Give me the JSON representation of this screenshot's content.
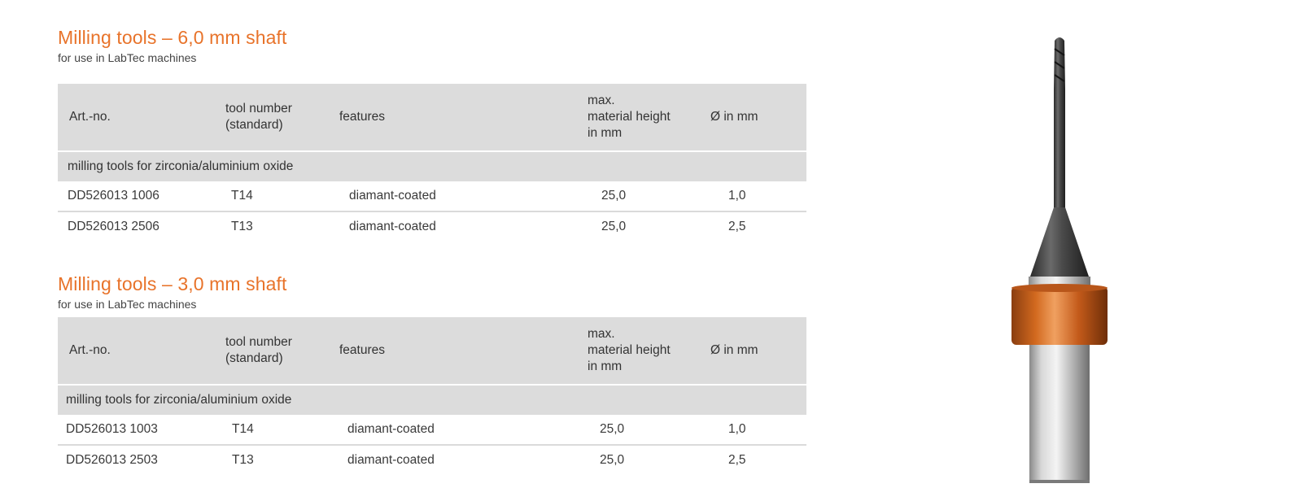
{
  "sections": [
    {
      "title": "Milling tools – 6,0 mm shaft",
      "subtitle": "for use in LabTec machines",
      "headers": {
        "art_no": "Art.-no.",
        "tool_number_line1": "tool number",
        "tool_number_line2": "(standard)",
        "features": "features",
        "max_line1": "max.",
        "max_line2": "material height",
        "max_line3": "in mm",
        "diameter": "Ø in mm"
      },
      "group": "milling tools for zirconia/aluminium oxide",
      "rows": [
        {
          "art_no": "DD526013 1006",
          "tool_number": "T14",
          "features": "diamant-coated",
          "max_height": "25,0",
          "diameter": "1,0"
        },
        {
          "art_no": "DD526013 2506",
          "tool_number": "T13",
          "features": "diamant-coated",
          "max_height": "25,0",
          "diameter": "2,5"
        }
      ]
    },
    {
      "title": "Milling tools – 3,0 mm shaft",
      "subtitle": "for use in LabTec machines",
      "headers": {
        "art_no": "Art.-no.",
        "tool_number_line1": "tool number",
        "tool_number_line2": "(standard)",
        "features": "features",
        "max_line1": "max.",
        "max_line2": "material height",
        "max_line3": "in mm",
        "diameter": "Ø in mm"
      },
      "group": "milling tools for zirconia/aluminium oxide",
      "rows": [
        {
          "art_no": "DD526013 1003",
          "tool_number": "T14",
          "features": "diamant-coated",
          "max_height": "25,0",
          "diameter": "1,0"
        },
        {
          "art_no": "DD526013 2503",
          "tool_number": "T13",
          "features": "diamant-coated",
          "max_height": "25,0",
          "diameter": "2,5"
        }
      ]
    }
  ],
  "colors": {
    "accent": "#e8732a",
    "header_bg": "#dcdcdc",
    "collar": "#c8601e"
  }
}
